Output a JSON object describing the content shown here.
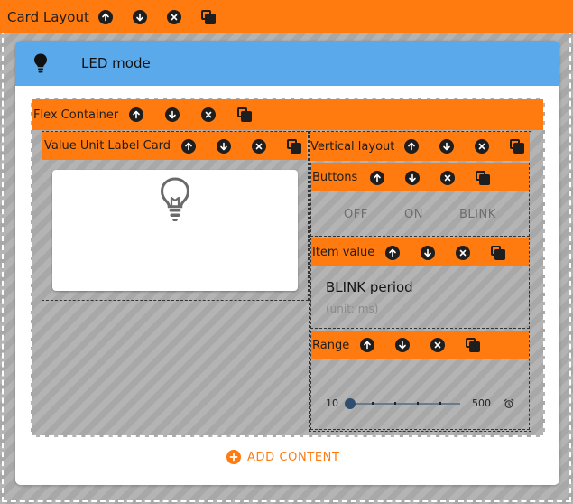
{
  "card_layout": {
    "title": "Card Layout"
  },
  "card": {
    "title": "LED mode"
  },
  "flex": {
    "title": "Flex Container"
  },
  "value_card": {
    "title": "Value Unit Label Card"
  },
  "vertical": {
    "title": "Vertical layout"
  },
  "buttons_block": {
    "title": "Buttons",
    "options": [
      "OFF",
      "ON",
      "BLINK"
    ]
  },
  "item_value": {
    "title": "Item value",
    "name": "BLINK period",
    "unit": "(unit: ms)"
  },
  "range": {
    "title": "Range",
    "min": "10",
    "max": "500",
    "value": 10
  },
  "add_content": {
    "label": "ADD CONTENT"
  },
  "colors": {
    "accent": "#ff7a0f",
    "header_blue": "#5aaaeb",
    "hatch": "#a8a8a8"
  },
  "icons": [
    "arrow-up-icon",
    "arrow-down-icon",
    "close-icon",
    "copy-icon",
    "lightbulb-icon",
    "alarm-icon",
    "plus-icon"
  ]
}
